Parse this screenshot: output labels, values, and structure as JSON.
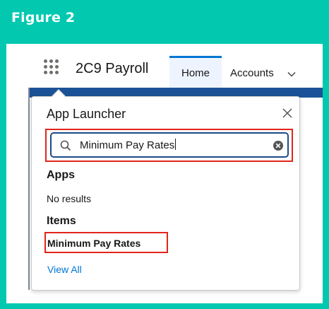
{
  "figure": {
    "title": "Figure 2"
  },
  "nav": {
    "app_name": "2C9 Payroll",
    "tabs": [
      {
        "label": "Home",
        "active": true
      },
      {
        "label": "Accounts",
        "active": false
      }
    ]
  },
  "app_launcher": {
    "title": "App Launcher",
    "search": {
      "value": "Minimum Pay Rates"
    },
    "apps_heading": "Apps",
    "apps_empty": "No results",
    "items_heading": "Items",
    "items": [
      {
        "label": "Minimum Pay Rates"
      }
    ],
    "view_all": "View All"
  },
  "colors": {
    "frame": "#02c8b0",
    "brand_blue": "#0176d3",
    "highlight_red": "#e1251b",
    "search_border": "#1b4b8a"
  },
  "icons": [
    "app-launcher-waffle-icon",
    "chevron-down-icon",
    "close-icon",
    "search-icon",
    "clear-icon"
  ]
}
